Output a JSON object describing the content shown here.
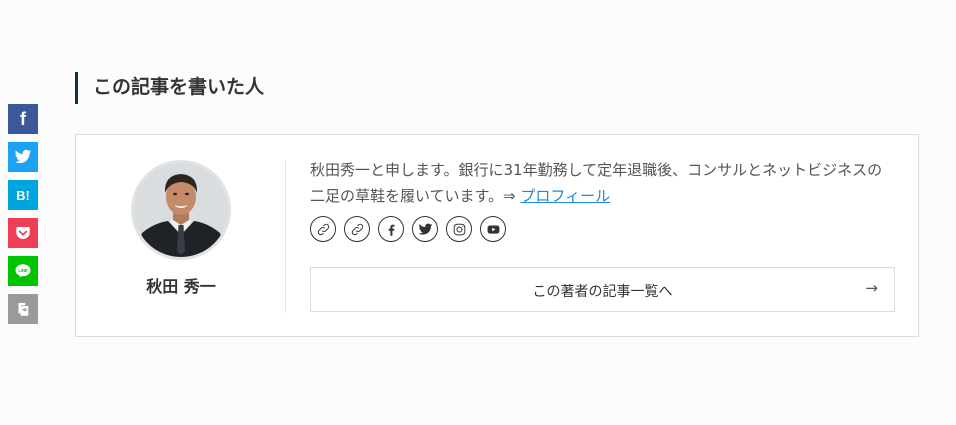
{
  "share": {
    "facebook_label": "f",
    "hatena_label": "B!",
    "icons": [
      "facebook-icon",
      "twitter-icon",
      "hatena-bookmark-icon",
      "pocket-icon",
      "line-icon",
      "copy-icon"
    ],
    "colors": {
      "facebook": "#3b5998",
      "twitter": "#1da1f2",
      "hatena": "#00a4de",
      "pocket": "#ef3f56",
      "line": "#00c300",
      "copy": "#9a9a9a"
    },
    "line_label": "LINE"
  },
  "section": {
    "title": "この記事を書いた人"
  },
  "author": {
    "name": "秋田 秀一",
    "bio_text": "秋田秀一と申します。銀行に31年勤務して定年退職後、コンサルとネットビジネスの二足の草鞋を履いています。⇒ ",
    "profile_link": "プロフィール",
    "social_icons": [
      "link-icon",
      "link-icon",
      "facebook-icon",
      "twitter-icon",
      "instagram-icon",
      "youtube-icon"
    ],
    "posts_link_label": "この著者の記事一覧へ",
    "posts_link_arrow": "→"
  }
}
